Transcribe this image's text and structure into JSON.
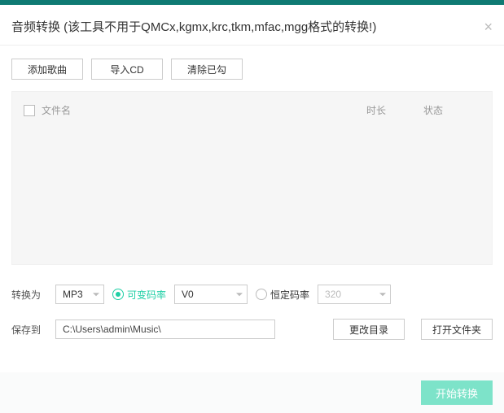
{
  "header": {
    "title": "音频转换 (该工具不用于QMCx,kgmx,krc,tkm,mfac,mgg格式的转换!)"
  },
  "toolbar": {
    "add_songs": "添加歌曲",
    "import_cd": "导入CD",
    "clear_checked": "清除已勾"
  },
  "list": {
    "col_filename": "文件名",
    "col_duration": "时长",
    "col_status": "状态"
  },
  "convert": {
    "label": "转换为",
    "format_value": "MP3",
    "radio_vbr_label": "可变码率",
    "vbr_value": "V0",
    "radio_cbr_label": "恒定码率",
    "cbr_value": "320"
  },
  "save": {
    "label": "保存到",
    "path_value": "C:\\Users\\admin\\Music\\",
    "change_dir": "更改目录",
    "open_folder": "打开文件夹"
  },
  "footer": {
    "start": "开始转换"
  }
}
